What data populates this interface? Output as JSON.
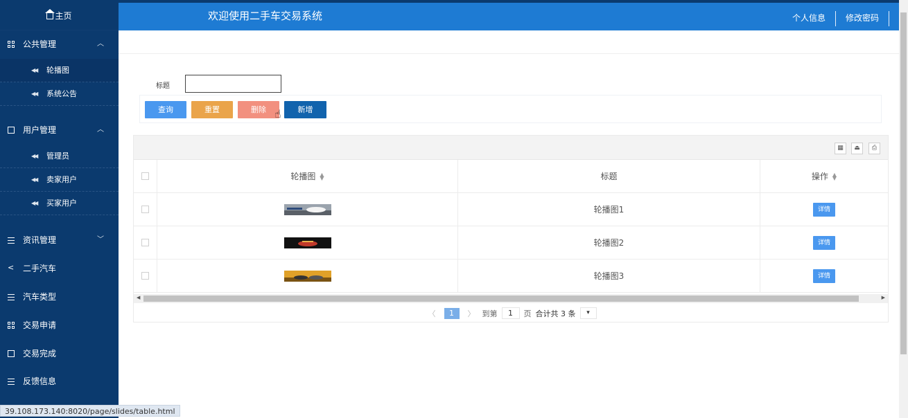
{
  "sidebar": {
    "home": "主页",
    "groups": [
      {
        "label": "公共管理",
        "icon": "grid-icon",
        "expanded": true,
        "items": [
          {
            "label": "轮播图",
            "active": true
          },
          {
            "label": "系统公告"
          }
        ]
      },
      {
        "label": "用户管理",
        "icon": "book-icon",
        "expanded": true,
        "items": [
          {
            "label": "管理员"
          },
          {
            "label": "卖家用户"
          },
          {
            "label": "买家用户"
          }
        ]
      },
      {
        "label": "资讯管理",
        "icon": "list-icon",
        "expanded": false
      },
      {
        "label": "二手汽车",
        "icon": "share-icon"
      },
      {
        "label": "汽车类型",
        "icon": "list-icon"
      },
      {
        "label": "交易申请",
        "icon": "grid-icon"
      },
      {
        "label": "交易完成",
        "icon": "book-icon"
      },
      {
        "label": "反馈信息",
        "icon": "list-icon"
      }
    ]
  },
  "header": {
    "title": "欢迎使用二手车交易系统",
    "nav": [
      "个人信息",
      "修改密码"
    ]
  },
  "search": {
    "label": "标题",
    "value": ""
  },
  "buttons": {
    "query": "查询",
    "reset": "重置",
    "delete": "删除",
    "add": "新增"
  },
  "table": {
    "columns": [
      "轮播图",
      "标题",
      "操作"
    ],
    "rows": [
      {
        "title": "轮播图1",
        "action": "详情"
      },
      {
        "title": "轮播图2",
        "action": "详情"
      },
      {
        "title": "轮播图3",
        "action": "详情"
      }
    ]
  },
  "pager": {
    "current": "1",
    "goto_label": "到第",
    "goto_value": "1",
    "page_unit": "页",
    "total": "合计共 3 条"
  },
  "status_url": "39.108.173.140:8020/page/slides/table.html"
}
